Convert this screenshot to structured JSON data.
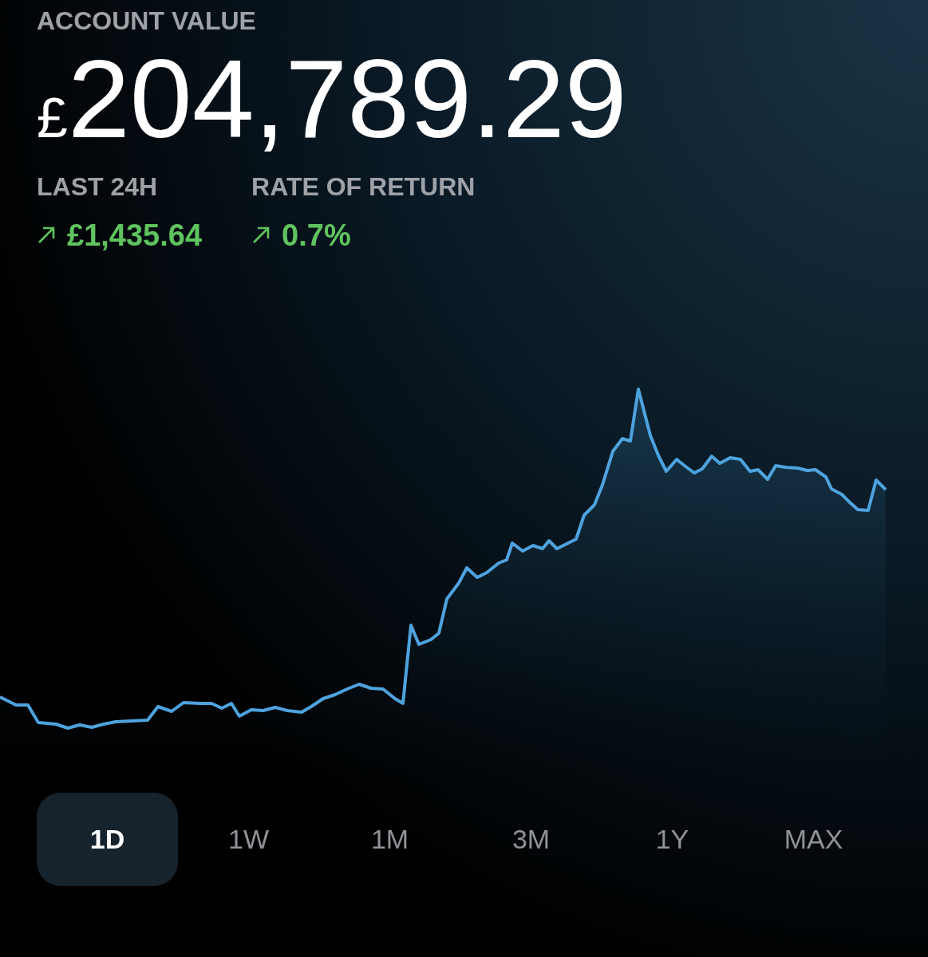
{
  "header": {
    "label": "ACCOUNT VALUE",
    "currency": "£",
    "amount": "204,789.29"
  },
  "metrics": [
    {
      "label": "LAST 24H",
      "value": "£1,435.64"
    },
    {
      "label": "RATE OF RETURN",
      "value": "0.7%"
    }
  ],
  "ranges": [
    {
      "label": "1D",
      "selected": true
    },
    {
      "label": "1W",
      "selected": false
    },
    {
      "label": "1M",
      "selected": false
    },
    {
      "label": "3M",
      "selected": false
    },
    {
      "label": "1Y",
      "selected": false
    },
    {
      "label": "MAX",
      "selected": false
    }
  ]
}
